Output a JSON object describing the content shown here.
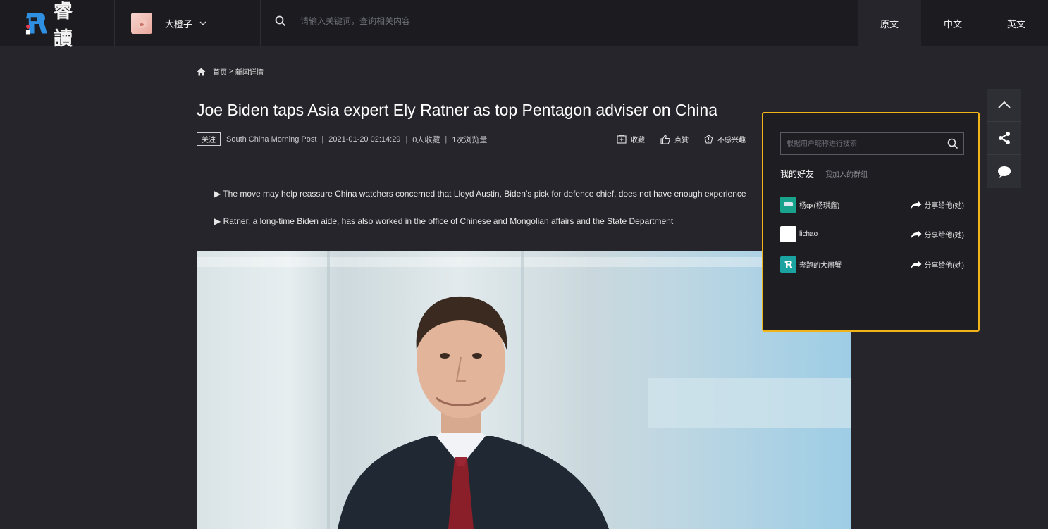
{
  "brand": {
    "name": "睿讀"
  },
  "user": {
    "name": "大橙子"
  },
  "search": {
    "placeholder": "请输入关键词，查询相关内容"
  },
  "languages": [
    {
      "label": "原文",
      "active": true
    },
    {
      "label": "中文",
      "active": false
    },
    {
      "label": "英文",
      "active": false
    }
  ],
  "breadcrumb": {
    "home": "首页",
    "separator": ">",
    "current": "新闻详情"
  },
  "article": {
    "title": "Joe Biden taps Asia expert Ely Ratner as top Pentagon adviser on China",
    "follow_label": "关注",
    "source": "South China Morning Post",
    "datetime": "2021-01-20 02:14:29",
    "favorites": "0人收藏",
    "views": "1次浏览量",
    "meta_separator": "|",
    "actions": {
      "favorite": "收藏",
      "like": "点赞",
      "not_interested": "不感兴趣"
    },
    "bullets": [
      "▶ The move may help reassure China watchers concerned that Lloyd Austin, Biden’s pick for defence chief, does not have enough experience",
      "▶ Ratner, a long-time Biden aide, has also worked in the office of Chinese and Mongolian affairs and the State Department"
    ]
  },
  "side_tools": [
    "chevron-up-icon",
    "share-icon",
    "comment-icon"
  ],
  "share_popup": {
    "search_placeholder": "根据用户昵称进行搜索",
    "tabs": [
      {
        "label": "我的好友",
        "active": true
      },
      {
        "label": "我加入的群组",
        "active": false
      }
    ],
    "friends": [
      {
        "name": "杨qx(杨琪鑫)",
        "action": "分享给他(她)",
        "avatar_color": "#1aa38c"
      },
      {
        "name": "lichao",
        "action": "分享给他(她)",
        "avatar_color": "#ffffff"
      },
      {
        "name": "奔跑的大闸蟹",
        "action": "分享给他(她)",
        "avatar_color": "#1aa3a0"
      }
    ]
  }
}
